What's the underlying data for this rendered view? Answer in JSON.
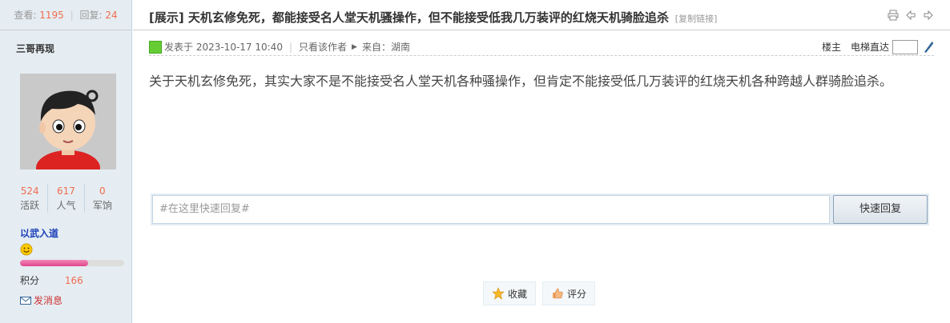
{
  "sidebar": {
    "views_label": "查看:",
    "views": "1195",
    "replies_label": "回复:",
    "replies": "24",
    "author": "三哥再现",
    "stats": [
      {
        "value": "524",
        "label": "活跃"
      },
      {
        "value": "617",
        "label": "人气"
      },
      {
        "value": "0",
        "label": "军饷"
      }
    ],
    "group": "以武入道",
    "level_progress": 0.65,
    "credit_label": "积分",
    "credit_value": "166",
    "pm_label": "发消息"
  },
  "post": {
    "title": "[展示] 天机玄修免死，都能接受名人堂天机骚操作，但不能接受低我几万装评的红烧天机骑脸追杀",
    "copy_link": "[复制链接]",
    "posted": "发表于 2023-10-17 10:40",
    "author_only": "只看该作者",
    "origin": "来自：湖南",
    "floor_label": "楼主",
    "jump_label": "电梯直达",
    "content": "关于天机玄修免死，其实大家不是不能接受名人堂天机各种骚操作，但肯定不能接受低几万装评的红烧天机各种跨越人群骑脸追杀。"
  },
  "quick_reply": {
    "placeholder": "#在这里快速回复#",
    "button": "快速回复"
  },
  "actions": {
    "favorite": "收藏",
    "rate": "评分"
  },
  "colors": {
    "accent": "#f26c4f",
    "sidebar_bg": "#e5edf2",
    "group": "#1a3fb8"
  }
}
